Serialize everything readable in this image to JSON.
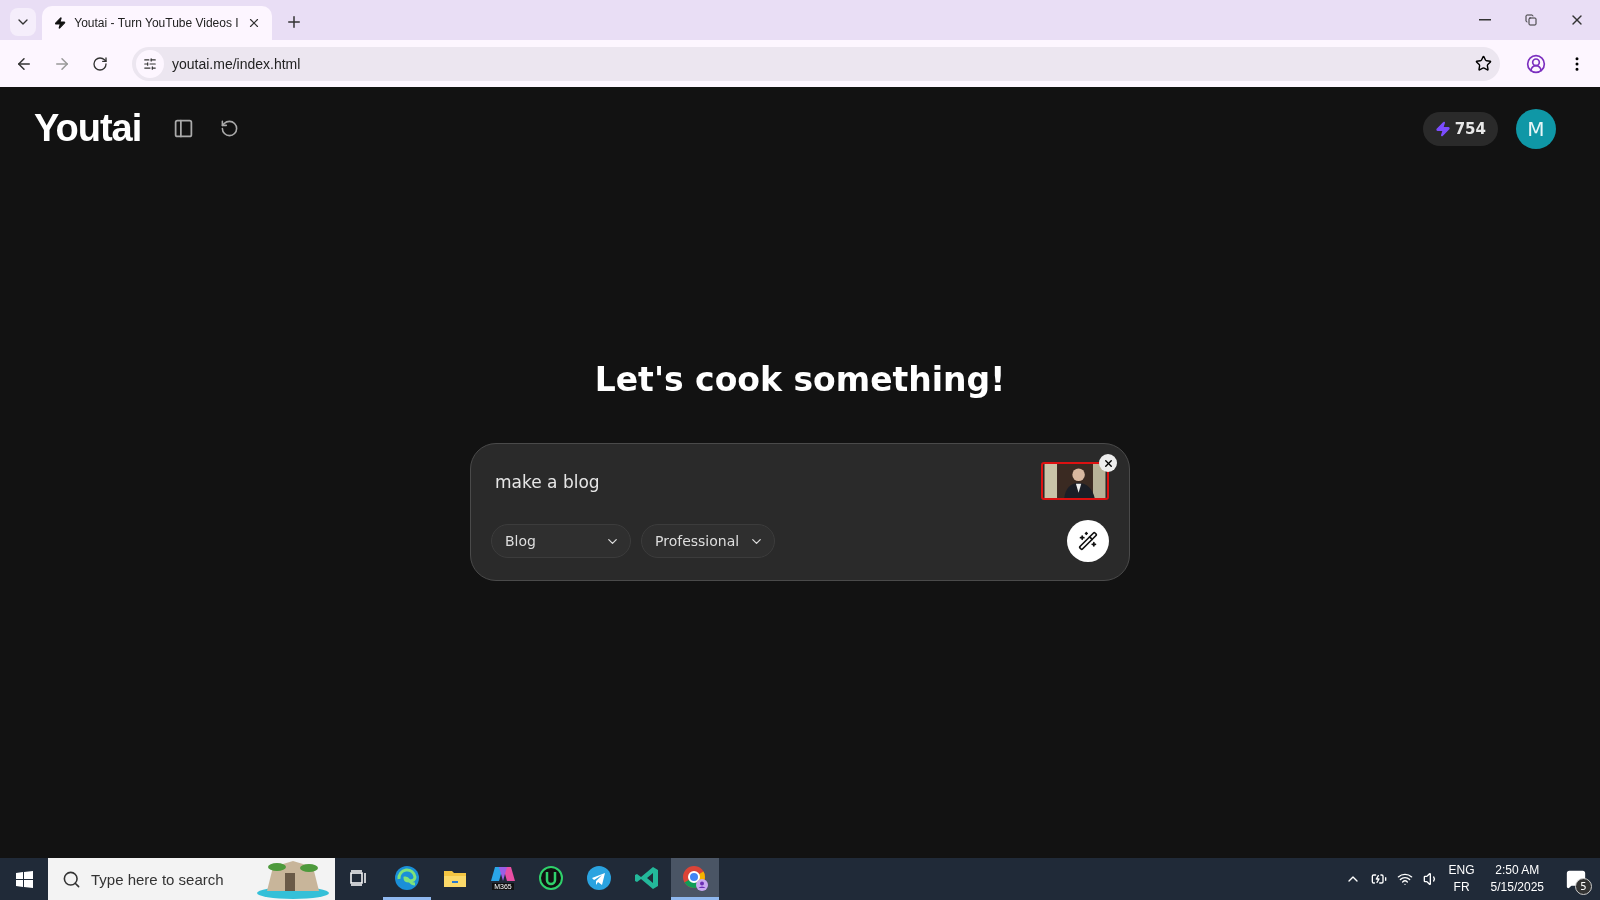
{
  "browser": {
    "tab": {
      "title": "Youtai - Turn YouTube Videos I"
    },
    "address": "youtai.me/index.html"
  },
  "header": {
    "logo": "Youtai",
    "credits": "754",
    "avatar": "M"
  },
  "heading": "Let's cook something!",
  "prompt": {
    "value": "make a blog",
    "selects": [
      {
        "value": "Blog"
      },
      {
        "value": "Professional"
      }
    ]
  },
  "taskbar": {
    "search_placeholder": "Type here to search",
    "apps": [
      {
        "kind": "taskview",
        "running": false,
        "selected": false
      },
      {
        "kind": "edge",
        "running": true,
        "selected": false
      },
      {
        "kind": "folder",
        "running": false,
        "selected": false
      },
      {
        "kind": "m365",
        "label": "M365",
        "running": false,
        "selected": false
      },
      {
        "kind": "u",
        "running": false,
        "selected": false
      },
      {
        "kind": "telegram",
        "running": false,
        "selected": false
      },
      {
        "kind": "vscode",
        "running": false,
        "selected": false
      },
      {
        "kind": "chrome",
        "running": true,
        "selected": true
      }
    ],
    "language": "ENG",
    "layout": "FR",
    "time": "2:50 AM",
    "date": "5/15/2025",
    "notifications": "5"
  }
}
